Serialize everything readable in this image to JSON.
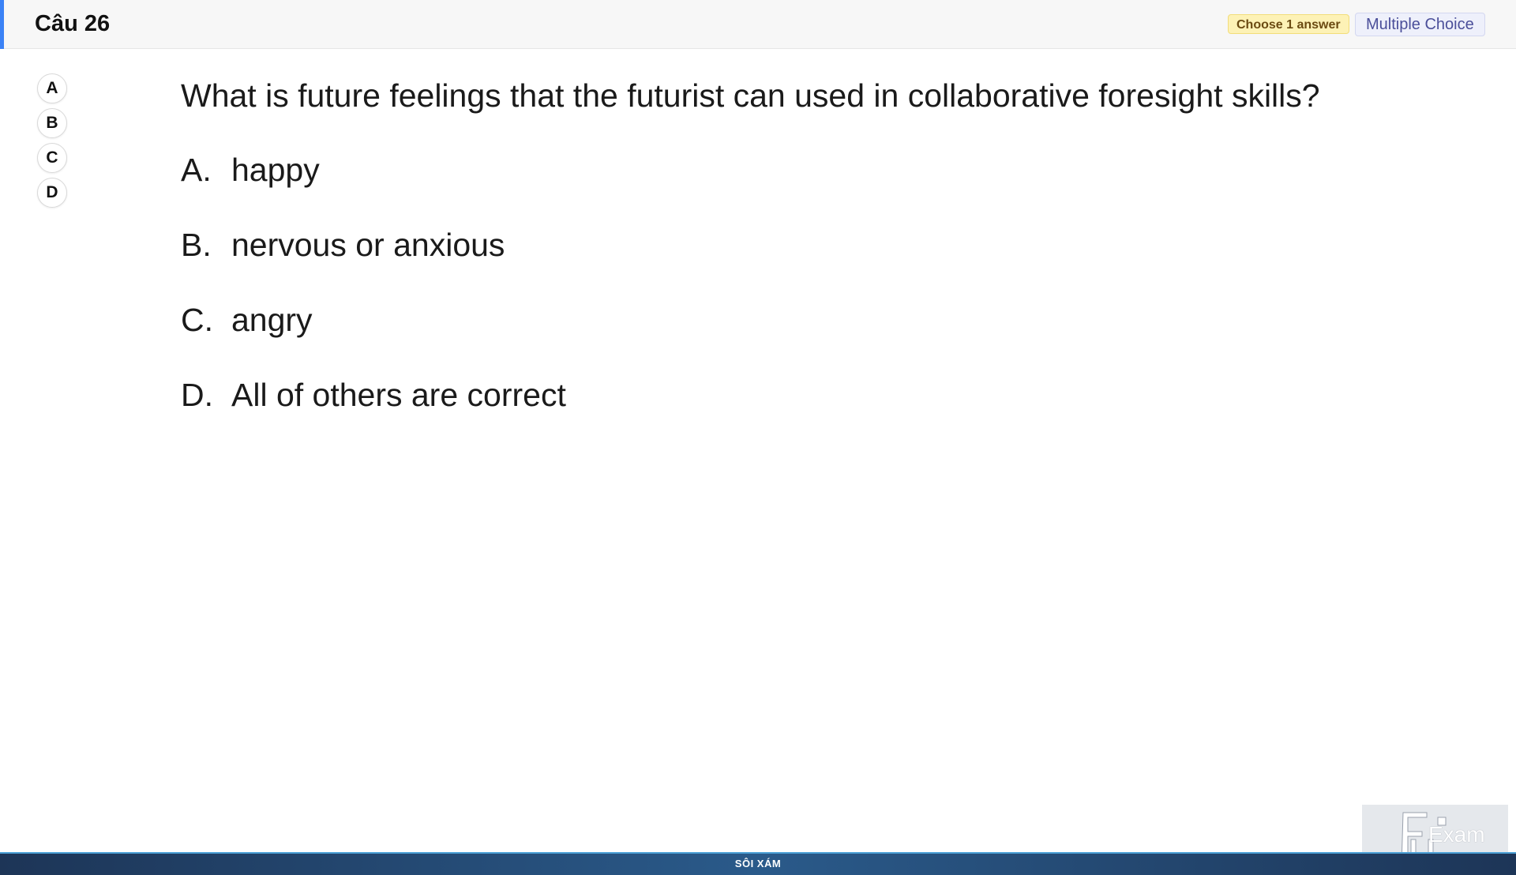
{
  "header": {
    "title": "Câu 26",
    "instruction_badge": "Choose 1 answer",
    "type_badge": "Multiple Choice",
    "accent_color": "#3b82f6"
  },
  "side_options": [
    "A",
    "B",
    "C",
    "D"
  ],
  "question": {
    "text": "What is future feelings that the futurist can used in collaborative foresight skills?",
    "choices": [
      {
        "letter": "A.",
        "text": "happy"
      },
      {
        "letter": "B.",
        "text": "nervous or anxious"
      },
      {
        "letter": "C.",
        "text": "angry"
      },
      {
        "letter": "D.",
        "text": "All of others are correct"
      }
    ]
  },
  "footer": {
    "label": "SÔI XÁM"
  },
  "logo": {
    "text": "Exam",
    "icon": "fu-logo-icon"
  }
}
